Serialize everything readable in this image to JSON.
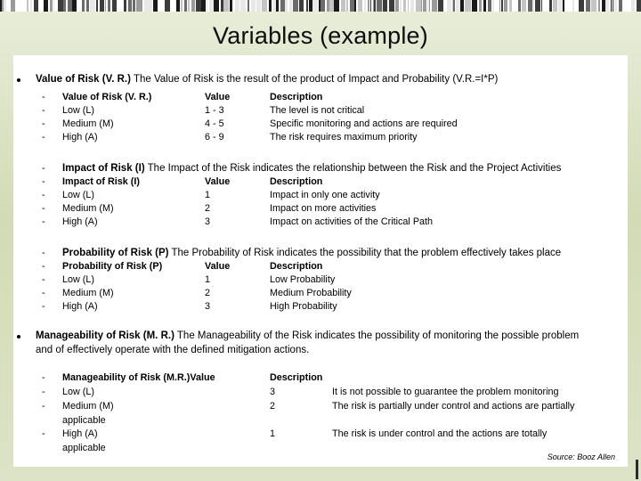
{
  "slide": {
    "title": "Variables (example)",
    "source_note": "Source: Booz Allen"
  },
  "sections": [
    {
      "id": "value-of-risk",
      "bullet_level": 1,
      "bold_lead": "Value of Risk (V. R.)",
      "paragraph": " The Value of Risk is the result of the product of Impact and Probability (V.R.=I*P)",
      "table": {
        "header": {
          "label": "Value of Risk (V. R.)",
          "value": "Value",
          "description": "Description"
        },
        "rows": [
          {
            "label": "Low (L)",
            "value": "1 - 3",
            "description": "The level is not critical"
          },
          {
            "label": "Medium (M)",
            "value": "4 - 5",
            "description": "Specific monitoring and actions are required"
          },
          {
            "label": "High (A)",
            "value": "6 - 9",
            "description": "The risk requires maximum priority"
          }
        ]
      }
    },
    {
      "id": "impact-of-risk",
      "bullet_level": 2,
      "bold_lead": "Impact of Risk (I)",
      "paragraph": " The Impact of the Risk indicates the relationship between the Risk and the Project Activities",
      "table": {
        "header": {
          "label": "Impact of Risk (I)",
          "value": "Value",
          "description": "Description"
        },
        "rows": [
          {
            "label": "Low (L)",
            "value": "1",
            "description": "Impact in only one activity"
          },
          {
            "label": "Medium (M)",
            "value": "2",
            "description": "Impact on more activities"
          },
          {
            "label": "High (A)",
            "value": "3",
            "description": "Impact on activities of the Critical Path"
          }
        ]
      }
    },
    {
      "id": "probability-of-risk",
      "bullet_level": 2,
      "bold_lead": "Probability of Risk (P)",
      "paragraph": " The Probability of Risk indicates the possibility that the problem effectively takes place",
      "table": {
        "header": {
          "label": "Probability of Risk (P)",
          "value": "Value",
          "description": "Description"
        },
        "rows": [
          {
            "label": "Low (L)",
            "value": "1",
            "description": "Low Probability"
          },
          {
            "label": "Medium (M)",
            "value": "2",
            "description": "Medium Probability"
          },
          {
            "label": "High (A)",
            "value": "3",
            "description": "High Probability"
          }
        ]
      }
    },
    {
      "id": "manageability-of-risk",
      "bullet_level": 1,
      "bold_lead": "Manageability of Risk (M. R.)",
      "paragraph": " The Manageability of the Risk indicates the possibility of monitoring the possible problem and of effectively operate with the defined mitigation actions.",
      "table": {
        "header": {
          "label": "Manageability of Risk (M.R.)Value",
          "value": "",
          "description": "Description"
        },
        "rows": [
          {
            "label": "Low (L)",
            "value": "3",
            "description": "It is not possible to guarantee the problem monitoring"
          },
          {
            "label": "Medium (M)\napplicable",
            "value": "2",
            "description": "The risk is partially under control and actions are partially"
          },
          {
            "label": "High (A)\napplicable",
            "value": "1",
            "description": "The risk is under control and the actions are totally"
          }
        ]
      }
    }
  ],
  "colors": {
    "background_green": "#d2dbb5",
    "panel": "#ffffff",
    "text": "#000000"
  }
}
